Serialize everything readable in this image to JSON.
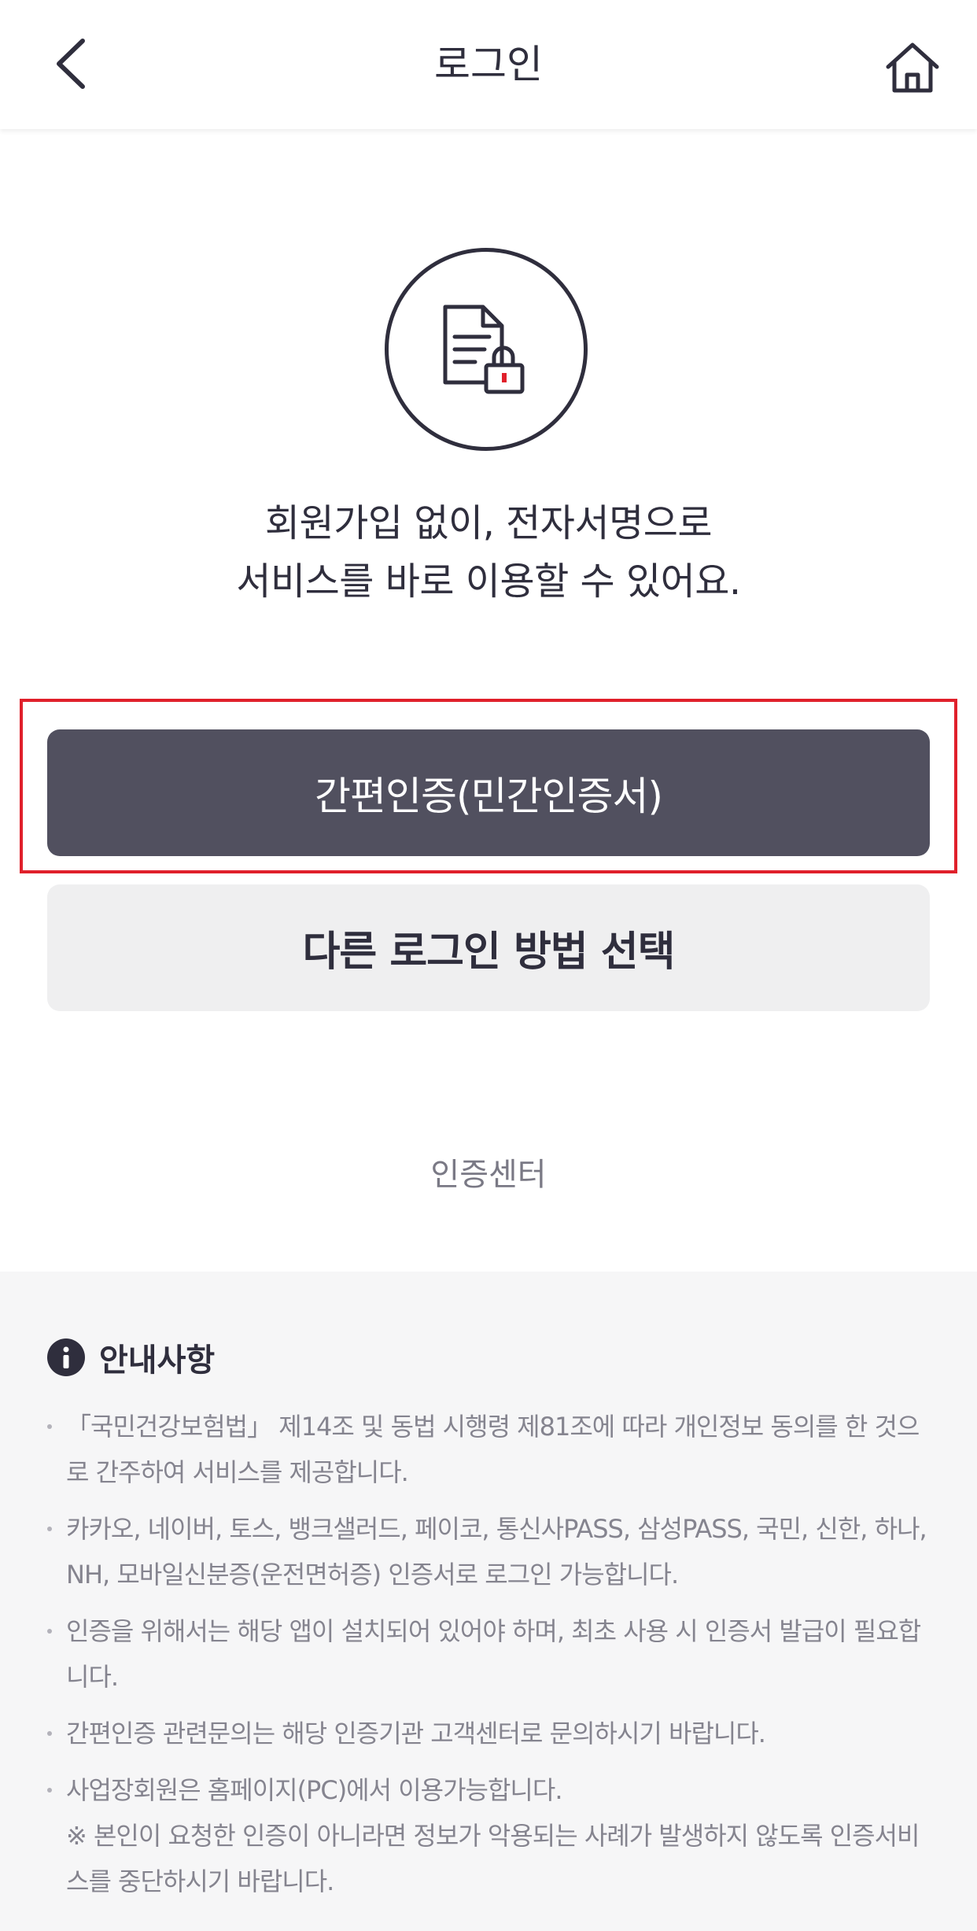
{
  "header": {
    "title": "로그인",
    "back_icon": "chevron-left-icon",
    "home_icon": "home-icon"
  },
  "hero": {
    "icon": "document-lock-icon",
    "line1": "회원가입 없이, 전자서명으로",
    "line2": "서비스를 바로 이용할 수 있어요."
  },
  "actions": {
    "primary_label": "간편인증(민간인증서)",
    "secondary_label": "다른 로그인 방법 선택",
    "cert_center_label": "인증센터"
  },
  "notice": {
    "title": "안내사항",
    "items": [
      "「국민건강보험법」 제14조 및 동법 시행령 제81조에 따라 개인정보 동의를 한 것으로 간주하여 서비스를 제공합니다.",
      "카카오, 네이버, 토스, 뱅크샐러드, 페이코, 통신사PASS, 삼성PASS, 국민, 신한, 하나, NH, 모바일신분증(운전면허증) 인증서로 로그인 가능합니다.",
      "인증을 위해서는 해당 앱이 설치되어 있어야 하며, 최초 사용 시 인증서 발급이 필요합니다.",
      "간편인증 관련문의는 해당 인증기관 고객센터로 문의하시기 바랍니다.",
      "사업장회원은 홈페이지(PC)에서 이용가능합니다."
    ],
    "sub_note": "※ 본인이 요청한 인증이 아니라면 정보가 악용되는 사례가 발생하지 않도록 인증서비스를 중단하시기 바랍니다."
  },
  "colors": {
    "primary": "#51505f",
    "highlight": "#e0202b",
    "lock_accent": "#e0202b",
    "text": "#2f2e3d"
  }
}
